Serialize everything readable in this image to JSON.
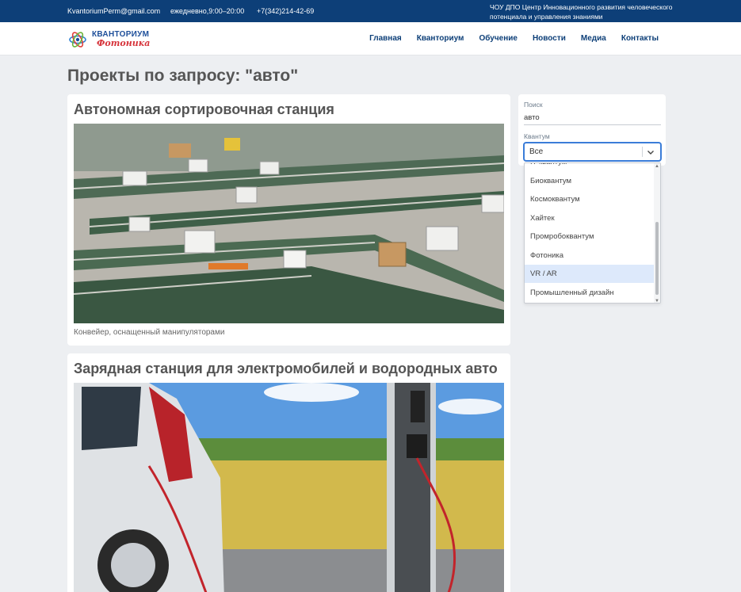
{
  "topbar": {
    "email": "KvantoriumPerm@gmail.com",
    "hours": "ежедневно,9:00–20:00",
    "phone": "+7(342)214-42-69",
    "org": "ЧОУ ДПО Центр Инновационного развития человеческого потенциала и управления знаниями"
  },
  "logo": {
    "line1": "КВАНТОРИУМ",
    "line2": "Фотоника"
  },
  "nav": [
    {
      "label": "Главная"
    },
    {
      "label": "Кванториум"
    },
    {
      "label": "Обучение"
    },
    {
      "label": "Новости"
    },
    {
      "label": "Медиа"
    },
    {
      "label": "Контакты"
    }
  ],
  "page_title": "Проекты по запросу: \"авто\"",
  "projects": [
    {
      "title": "Автономная сортировочная станция",
      "caption": "Конвейер, оснащенный манипуляторами"
    },
    {
      "title": "Зарядная станция для электромобилей и водородных авто",
      "caption": ""
    }
  ],
  "filters": {
    "search_label": "Поиск",
    "search_value": "авто",
    "kvant_label": "Квантум",
    "kvant_selected": "Все",
    "options": [
      {
        "label": "IT-квантум"
      },
      {
        "label": "Биоквантум"
      },
      {
        "label": "Космоквантум"
      },
      {
        "label": "Хайтек"
      },
      {
        "label": "Промробоквантум"
      },
      {
        "label": "Фотоника"
      },
      {
        "label": "VR / AR"
      },
      {
        "label": "Промышленный дизайн"
      }
    ],
    "highlighted_option": "VR / AR"
  },
  "colors": {
    "topbar": "#0d3f78",
    "nav_text": "#0d3f78",
    "accent": "#3b7dd8",
    "highlight": "#dde9fb"
  }
}
